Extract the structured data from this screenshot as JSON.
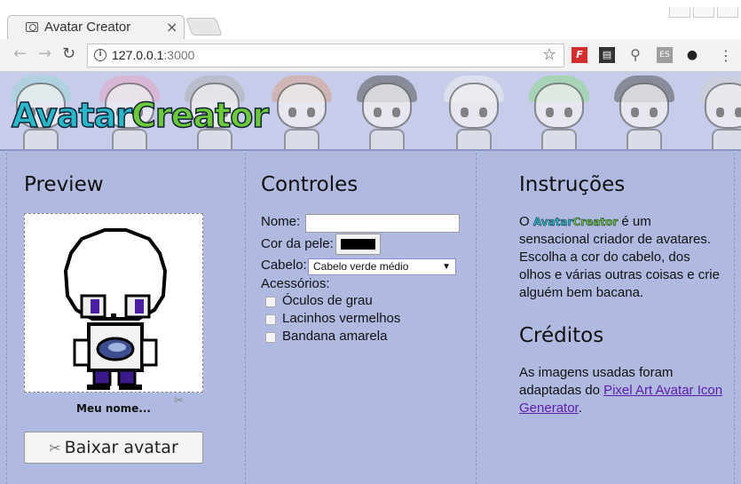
{
  "browser": {
    "tab_title": "Avatar Creator",
    "tab_close": "×",
    "url_host": "127.0.0.1",
    "url_port": ":3000",
    "extensions": [
      "F",
      "film-icon",
      "pin-icon",
      "ES",
      "octocat-icon"
    ]
  },
  "header": {
    "logo_part1": "Avatar",
    "logo_part2": "Creator"
  },
  "preview": {
    "heading": "Preview",
    "avatar_name": "Meu nome...",
    "download_label": "Baixar avatar"
  },
  "controls": {
    "heading": "Controles",
    "name_label": "Nome:",
    "name_value": "",
    "skin_label": "Cor da pele:",
    "skin_color": "#000000",
    "hair_label": "Cabelo:",
    "hair_selected": "Cabelo verde médio",
    "accessories_label": "Acessórios:",
    "accessories": [
      {
        "label": "Óculos de grau",
        "checked": false
      },
      {
        "label": "Lacinhos vermelhos",
        "checked": false
      },
      {
        "label": "Bandana amarela",
        "checked": false
      }
    ]
  },
  "instructions": {
    "heading": "Instruções",
    "text_prefix": "O",
    "logo_a": "Avatar",
    "logo_c": "Creator",
    "text_suffix": "é um sensacional criador de avatares. Escolha a cor do cabelo, dos olhos e várias outras coisas e crie alguém bem bacana.",
    "credits_heading": "Créditos",
    "credits_text": "As imagens usadas foram adaptadas do",
    "credits_link": "Pixel Art Avatar Icon Generator",
    "credits_end": "."
  },
  "colors": {
    "page_bg": "#b0b9df",
    "header_bg": "#c6ccea",
    "logo_cyan": "#2ab7c9",
    "logo_green": "#6cc93a",
    "link": "#5b1cad"
  }
}
